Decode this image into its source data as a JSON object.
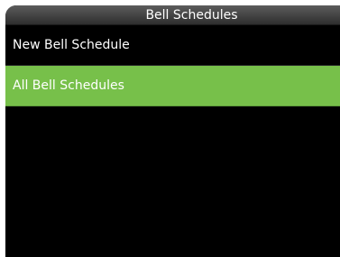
{
  "header": {
    "title": "Bell Schedules"
  },
  "menu": {
    "items": [
      {
        "label": "New Bell Schedule",
        "selected": false
      },
      {
        "label": "All Bell Schedules",
        "selected": true
      }
    ]
  },
  "colors": {
    "background": "#000000",
    "selected": "#77c04a",
    "text": "#ffffff"
  }
}
